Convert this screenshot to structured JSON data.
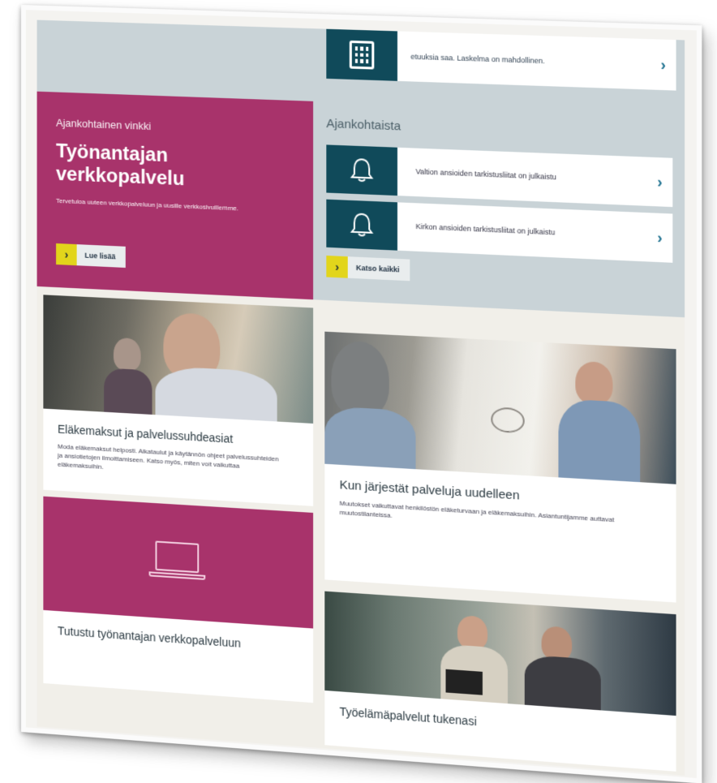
{
  "top_card": {
    "text": "etuuksia saa. Laskelma on mahdollinen.",
    "icon": "calculator-icon"
  },
  "tip": {
    "kicker": "Ajankohtainen vinkki",
    "title": "Työnantajan verkkopalvelu",
    "description": "Tervetuloa uuteen verkkopalveluun ja uusille verkkosivuillemme.",
    "button_label": "Lue lisää"
  },
  "news": {
    "heading": "Ajankohtaista",
    "items": [
      {
        "text": "Valtion ansioiden tarkistusliitat on julkaistu",
        "icon": "bell-icon"
      },
      {
        "text": "Kirkon ansioiden tarkistusliitat on julkaistu",
        "icon": "bell-icon"
      }
    ],
    "button_label": "Katso kaikki"
  },
  "cards": {
    "pension": {
      "title": "Eläkemaksut ja palvelussuhdeasiat",
      "description": "Moda eläkemaksut helposti. Aikataulut ja käytännön ohjeet palvelussuhteiden ja ansiotietojen ilmoittamiseen. Katso myös, miten voit vaikuttaa eläkemaksuihin."
    },
    "reorganize": {
      "title": "Kun järjestät palveluja uudelleen",
      "description": "Muutokset vaikuttavat henkilöstön eläketurvaan ja eläkemaksuihin. Asiantuntijamme auttavat muutostilanteissa."
    },
    "online_service": {
      "title": "Tutustu työnantajan verkkopalveluun",
      "icon": "laptop-icon"
    },
    "worklife": {
      "title": "Työelämäpalvelut tukenasi"
    }
  },
  "colors": {
    "magenta": "#a8336b",
    "teal": "#104a5a",
    "slate": "#c9d3d7",
    "accent_yellow": "#e2d51b"
  }
}
